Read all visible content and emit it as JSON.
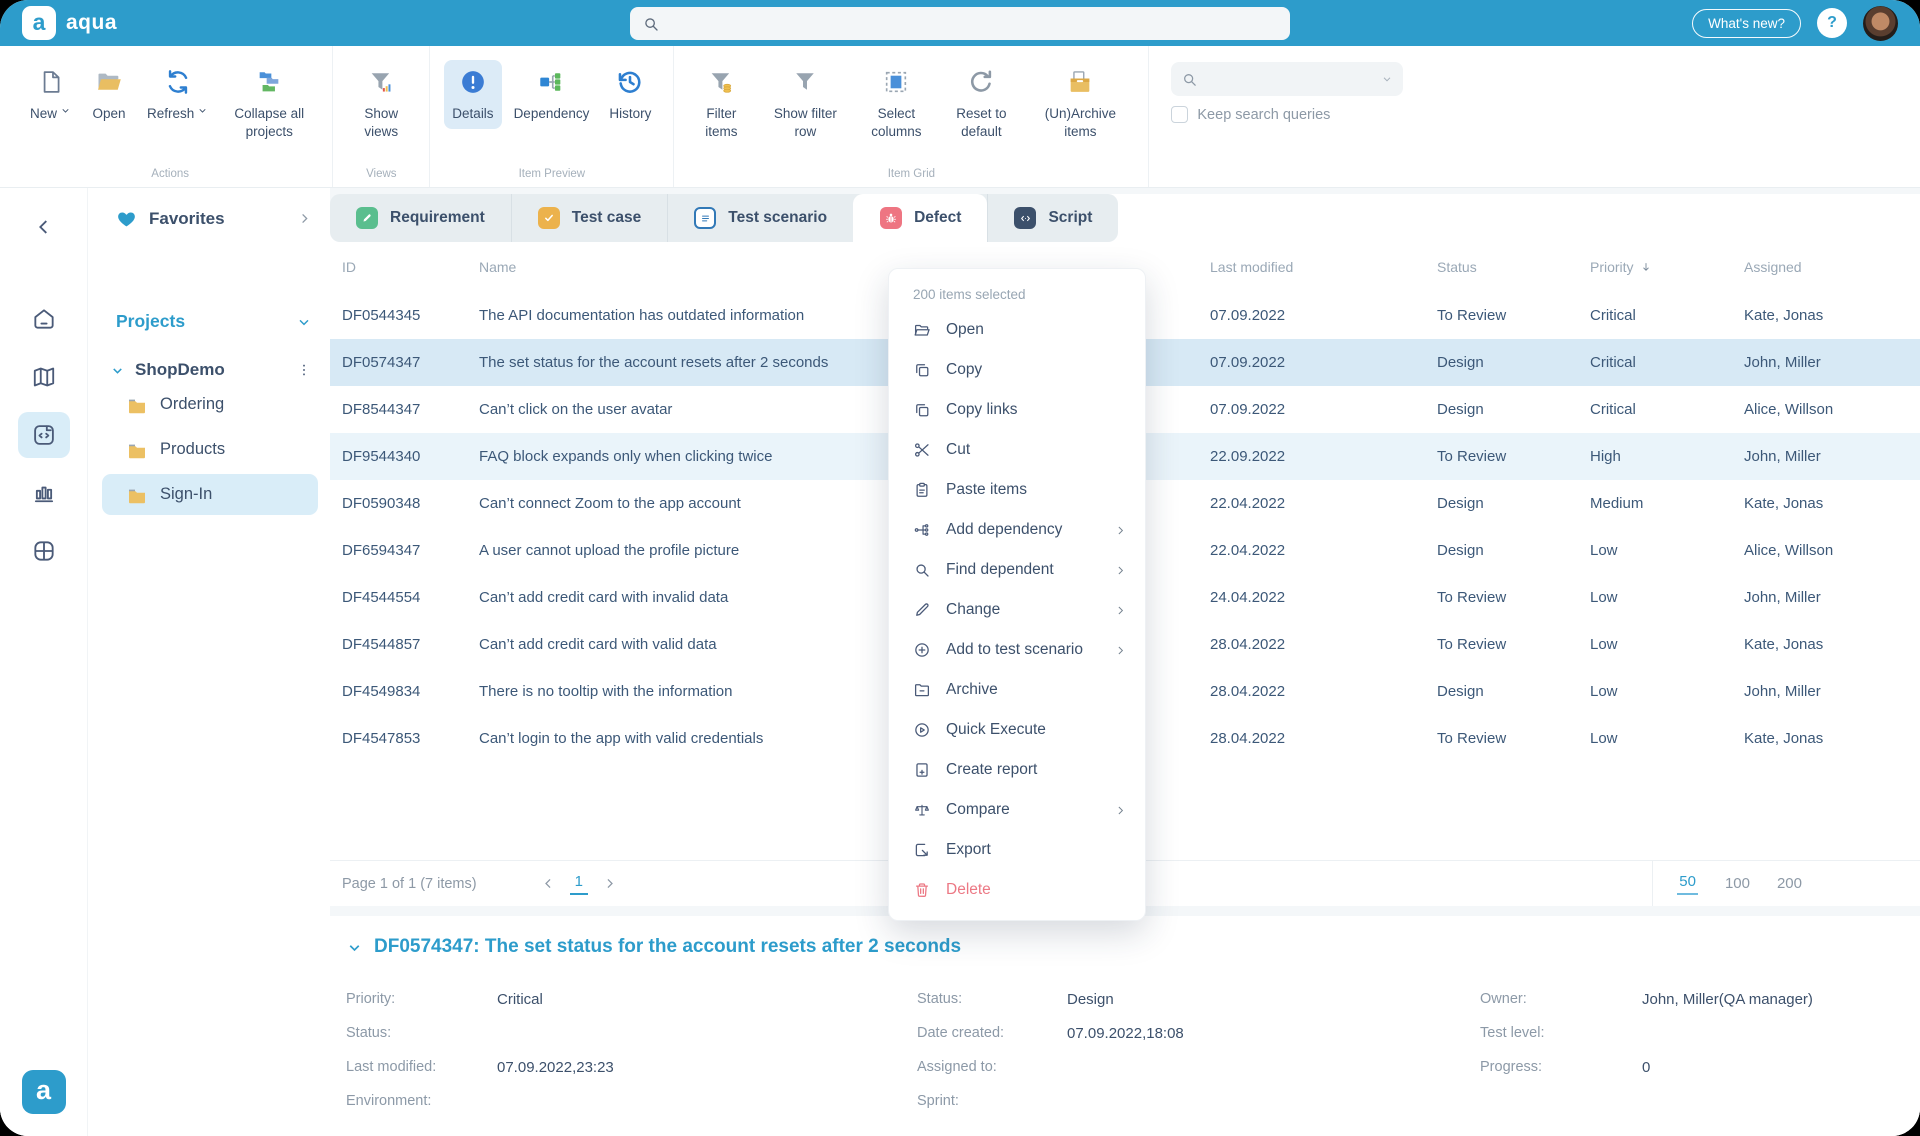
{
  "window": {
    "brand": "aqua",
    "logo_glyph": "a",
    "whats_new": "What's new?",
    "help": "?"
  },
  "colors": {
    "topbar": "#2D9CCB",
    "accent": "#2D9CCB",
    "selected_row": "#D7E9F5",
    "sidebar_selected": "#D9EDF8",
    "danger": "#EC7884",
    "folder_yellow": "#ECC063"
  },
  "ribbon": {
    "groups": [
      {
        "label": "Actions",
        "buttons": [
          {
            "label": "New",
            "dropdown": true
          },
          {
            "label": "Open"
          },
          {
            "label": "Refresh",
            "dropdown": true
          },
          {
            "label": "Collapse all projects"
          }
        ]
      },
      {
        "label": "Views",
        "buttons": [
          {
            "label": "Show views"
          }
        ]
      },
      {
        "label": "Item Preview",
        "buttons": [
          {
            "label": "Details",
            "active": true
          },
          {
            "label": "Dependency"
          },
          {
            "label": "History"
          }
        ]
      },
      {
        "label": "Item Grid",
        "buttons": [
          {
            "label": "Filter items"
          },
          {
            "label": "Show filter row"
          },
          {
            "label": "Select columns"
          },
          {
            "label": "Reset to default"
          },
          {
            "label": "(Un)Archive items"
          }
        ]
      }
    ],
    "search": {
      "value": "",
      "keep_queries_label": "Keep search queries",
      "keep_queries_checked": false
    }
  },
  "sidebar": {
    "favorites_label": "Favorites",
    "projects_label": "Projects",
    "tree": {
      "project": "ShopDemo",
      "folders": [
        {
          "label": "Ordering"
        },
        {
          "label": "Products"
        },
        {
          "label": "Sign-In",
          "selected": true
        }
      ]
    }
  },
  "tabs": [
    {
      "label": "Requirement"
    },
    {
      "label": "Test case"
    },
    {
      "label": "Test scenario"
    },
    {
      "label": "Defect",
      "active": true
    },
    {
      "label": "Script"
    }
  ],
  "grid": {
    "columns": [
      "ID",
      "Name",
      "Last modified",
      "Status",
      "Priority",
      "Assigned"
    ],
    "sort": {
      "column": "Priority",
      "direction": "desc"
    },
    "selected_id": "DF0574347",
    "rows": [
      {
        "id": "DF0544345",
        "name": "The API documentation has outdated information",
        "modified": "07.09.2022",
        "status": "To Review",
        "priority": "Critical",
        "assigned": "Kate, Jonas"
      },
      {
        "id": "DF0574347",
        "name": "The set status for the account resets after 2 seconds",
        "modified": "07.09.2022",
        "status": "Design",
        "priority": "Critical",
        "assigned": "John, Miller"
      },
      {
        "id": "DF8544347",
        "name": "Can’t click on the user avatar",
        "modified": "07.09.2022",
        "status": "Design",
        "priority": "Critical",
        "assigned": "Alice, Willson"
      },
      {
        "id": "DF9544340",
        "name": "FAQ block expands only when clicking twice",
        "modified": "22.09.2022",
        "status": "To Review",
        "priority": "High",
        "assigned": "John, Miller"
      },
      {
        "id": "DF0590348",
        "name": "Can’t connect Zoom to the app account",
        "modified": "22.04.2022",
        "status": "Design",
        "priority": "Medium",
        "assigned": "Kate, Jonas"
      },
      {
        "id": "DF6594347",
        "name": "A user cannot upload the profile picture",
        "modified": "22.04.2022",
        "status": "Design",
        "priority": "Low",
        "assigned": "Alice, Willson"
      },
      {
        "id": "DF4544554",
        "name": "Can’t add credit card with invalid data",
        "modified": "24.04.2022",
        "status": "To Review",
        "priority": "Low",
        "assigned": "John, Miller"
      },
      {
        "id": "DF4544857",
        "name": "Can’t add credit card with valid data",
        "modified": "28.04.2022",
        "status": "To Review",
        "priority": "Low",
        "assigned": "Kate, Jonas"
      },
      {
        "id": "DF4549834",
        "name": "There is no tooltip with the information",
        "modified": "28.04.2022",
        "status": "Design",
        "priority": "Low",
        "assigned": "John, Miller"
      },
      {
        "id": "DF4547853",
        "name": "Can’t login to the app with valid credentials",
        "modified": "28.04.2022",
        "status": "To Review",
        "priority": "Low",
        "assigned": "Kate, Jonas"
      }
    ]
  },
  "menu": {
    "header": "200 items selected",
    "items": [
      {
        "label": "Open"
      },
      {
        "label": "Copy"
      },
      {
        "label": "Copy links"
      },
      {
        "label": "Cut"
      },
      {
        "label": "Paste items"
      },
      {
        "label": "Add dependency",
        "submenu": true
      },
      {
        "label": "Find dependent",
        "submenu": true
      },
      {
        "label": "Change",
        "submenu": true
      },
      {
        "label": "Add to test scenario",
        "submenu": true
      },
      {
        "label": "Archive"
      },
      {
        "label": "Quick Execute"
      },
      {
        "label": "Create report"
      },
      {
        "label": "Compare",
        "submenu": true
      },
      {
        "label": "Export"
      },
      {
        "label": "Delete",
        "danger": true
      }
    ]
  },
  "pagination": {
    "summary": "Page 1 of 1 (7 items)",
    "current_page": "1",
    "page_sizes": [
      "50",
      "100",
      "200"
    ],
    "active_page_size": "50"
  },
  "detail": {
    "title": "DF0574347: The set status for the account resets after 2 seconds",
    "columns": [
      {
        "fields": [
          {
            "label": "Priority:",
            "value": "Critical"
          },
          {
            "label": "Status:",
            "value": ""
          },
          {
            "label": "Last modified:",
            "value": "07.09.2022,23:23"
          },
          {
            "label": "Environment:",
            "value": ""
          }
        ]
      },
      {
        "fields": [
          {
            "label": "Status:",
            "value": "Design"
          },
          {
            "label": "Date created:",
            "value": "07.09.2022,18:08"
          },
          {
            "label": "Assigned to:",
            "value": ""
          },
          {
            "label": "Sprint:",
            "value": ""
          }
        ]
      },
      {
        "fields": [
          {
            "label": "Owner:",
            "value": "John, Miller(QA manager)"
          },
          {
            "label": "Test level:",
            "value": ""
          },
          {
            "label": "Progress:",
            "value": "0"
          }
        ]
      }
    ]
  }
}
